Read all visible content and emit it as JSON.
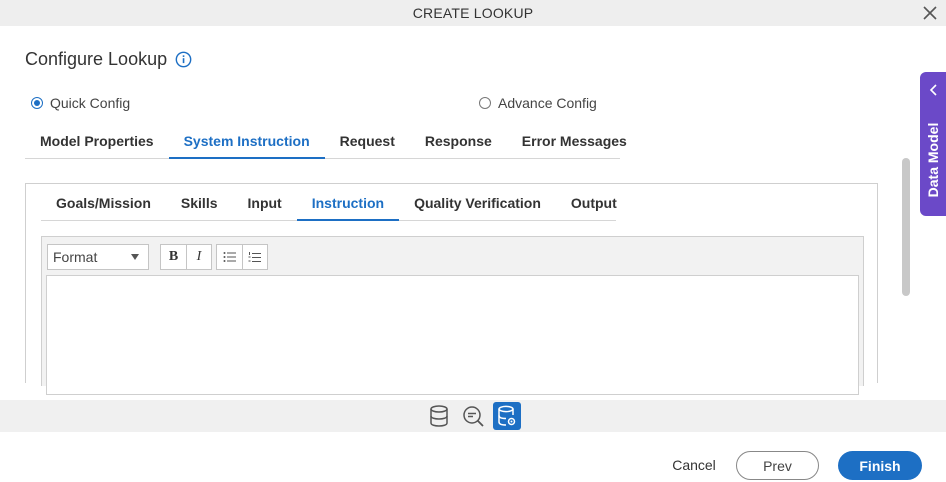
{
  "dialog": {
    "title": "CREATE LOOKUP",
    "close_icon": "close-icon"
  },
  "header": {
    "title": "Configure Lookup",
    "info_icon": "info-icon"
  },
  "config_mode": {
    "options": [
      {
        "label": "Quick Config",
        "selected": true
      },
      {
        "label": "Advance Config",
        "selected": false
      }
    ]
  },
  "main_tabs": {
    "items": [
      {
        "label": "Model Properties",
        "active": false
      },
      {
        "label": "System Instruction",
        "active": true
      },
      {
        "label": "Request",
        "active": false
      },
      {
        "label": "Response",
        "active": false
      },
      {
        "label": "Error Messages",
        "active": false
      }
    ]
  },
  "sub_tabs": {
    "items": [
      {
        "label": "Goals/Mission",
        "active": false
      },
      {
        "label": "Skills",
        "active": false
      },
      {
        "label": "Input",
        "active": false
      },
      {
        "label": "Instruction",
        "active": true
      },
      {
        "label": "Quality Verification",
        "active": false
      },
      {
        "label": "Output",
        "active": false
      }
    ]
  },
  "editor": {
    "format_select": "Format",
    "bold_label": "B",
    "italic_label": "I",
    "content": ""
  },
  "side_panel": {
    "label": "Data Model"
  },
  "bottom_icons": [
    {
      "name": "database-icon",
      "active": false
    },
    {
      "name": "search-minus-icon",
      "active": false
    },
    {
      "name": "database-settings-icon",
      "active": true
    }
  ],
  "footer": {
    "cancel_label": "Cancel",
    "prev_label": "Prev",
    "finish_label": "Finish"
  },
  "colors": {
    "accent": "#1d6fc4",
    "side_tab": "#6b49c8",
    "titlebar": "#eeeeee"
  }
}
